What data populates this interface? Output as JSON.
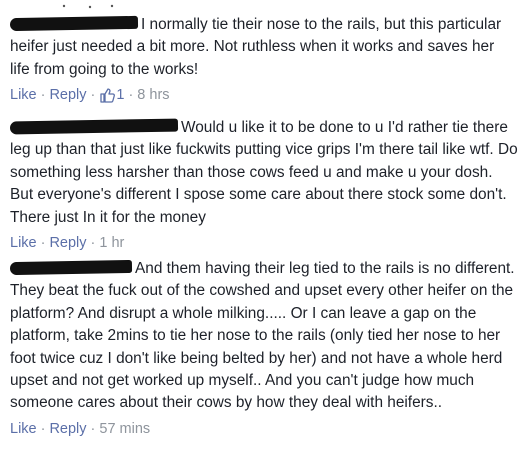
{
  "comments": [
    {
      "text": "I normally tie their nose to the rails, but this particular heifer just needed a bit more. Not ruthless when it works and saves her life from going to the works!",
      "like_label": "Like",
      "reply_label": "Reply",
      "reaction_count": "1",
      "time": "8 hrs"
    },
    {
      "text": "Would u like it to be done to u I'd rather tie there leg up than that just like fuckwits putting vice grips I'm there tail like wtf. Do something less harsher than those cows feed u and make u your dosh. But everyone's different I spose some care about there stock some don't. There just In it for the money",
      "like_label": "Like",
      "reply_label": "Reply",
      "time": "1 hr"
    },
    {
      "text": "And them having their leg tied to the rails is no different. They beat the fuck out of the cowshed and upset every other heifer on the platform? And disrupt a whole milking..... Or I can leave a gap on the platform, take 2mins to tie her nose to the rails (only tied her nose to her foot twice cuz I don't like being belted by her) and not have a whole herd upset and not get worked up myself.. And you can't judge how much someone cares about their cows by how they deal with heifers..",
      "like_label": "Like",
      "reply_label": "Reply",
      "time": "57 mins"
    }
  ],
  "icons": {
    "like": "thumbs-up-icon",
    "redaction": "redacted-name"
  },
  "colors": {
    "link": "#5b6fa8",
    "meta": "#8e949c",
    "text": "#1d2129"
  }
}
